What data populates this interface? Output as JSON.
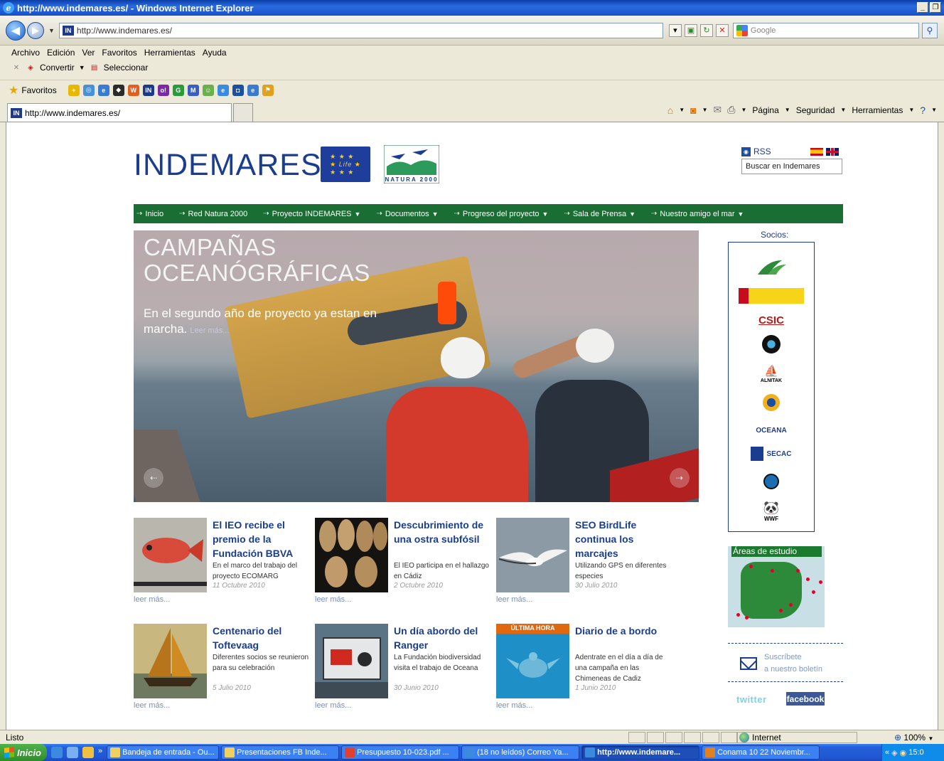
{
  "window": {
    "title": "http://www.indemares.es/ - Windows Internet Explorer",
    "address": "http://www.indemares.es/",
    "search_placeholder": "Google",
    "tab_title": "http://www.indemares.es/"
  },
  "menu": [
    "Archivo",
    "Edición",
    "Ver",
    "Favoritos",
    "Herramientas",
    "Ayuda"
  ],
  "toolbar2": {
    "convert": "Convertir",
    "select": "Seleccionar"
  },
  "favorites_label": "Favoritos",
  "commandbar": {
    "page": "Página",
    "security": "Seguridad",
    "tools": "Herramientas"
  },
  "site": {
    "logo": "INDEMARES",
    "natura_label": "NATURA 2000",
    "rss": "RSS",
    "search_value": "Buscar en Indemares",
    "nav": [
      {
        "label": "Inicio",
        "dropdown": false
      },
      {
        "label": "Red Natura 2000",
        "dropdown": false
      },
      {
        "label": "Proyecto INDEMARES",
        "dropdown": true
      },
      {
        "label": "Documentos",
        "dropdown": true
      },
      {
        "label": "Progreso del proyecto",
        "dropdown": true
      },
      {
        "label": "Sala de Prensa",
        "dropdown": true
      },
      {
        "label": "Nuestro amigo el mar",
        "dropdown": true
      }
    ],
    "hero": {
      "title_line1": "CAMPAÑAS",
      "title_line2": "OCEANÓGRÁFICAS",
      "subtitle": "En el segundo año de proyecto ya estan en marcha.",
      "more": "Leer más..."
    },
    "news": [
      {
        "title": "El IEO recibe el premio de la Fundación BBVA",
        "desc": "En el marco del trabajo del proyecto ECOMARG",
        "date": "11 Octubre 2010",
        "more": "leer más..."
      },
      {
        "title": "Descubrimiento de una ostra subfósil",
        "desc": "El IEO participa en el hallazgo en Cádiz",
        "date": "2 Octubre 2010",
        "more": "leer más..."
      },
      {
        "title": "SEO BirdLife continua los marcajes",
        "desc": "Utilizando GPS en diferentes especies",
        "date": "30 Julio 2010",
        "more": "leer más..."
      },
      {
        "title": "Centenario del Toftevaag",
        "desc": "Diferentes socios se reunieron para su celebración",
        "date": "5 Julio 2010",
        "more": "leer más..."
      },
      {
        "title": "Un día abordo del Ranger",
        "desc": "La Fundación biodiversidad visita el trabajo de Oceana",
        "date": "30 Junio 2010",
        "more": "leer más..."
      },
      {
        "title": "Diario de a bordo",
        "desc": "Adentrate en el día a día de una campaña en las Chimeneas de Cadiz",
        "date": "1 Junio 2010",
        "more": "leer más...",
        "badge": "ÚLTIMA HORA"
      }
    ],
    "socios_title": "Socios:",
    "socios": [
      "Fundación Biodiversidad",
      "Gobierno de España",
      "CSIC",
      "IEO",
      "ALNITAK",
      "CEMMA",
      "OCEANA",
      "SECAC",
      "SEO/BirdLife",
      "WWF"
    ],
    "socios_text": {
      "csic": "CSIC",
      "oceana": "OCEANA",
      "secac": "SECAC",
      "alnitak": "ALNITAK",
      "wwf": "WWF"
    },
    "areas_label": "Áreas de estudio",
    "newsletter_line1": "Suscríbete",
    "newsletter_line2": "a nuestro boletín",
    "twitter": "twitter",
    "facebook": "facebook"
  },
  "status": {
    "text": "Listo",
    "zone": "Internet",
    "zoom": "100%"
  },
  "taskbar": {
    "start": "Inicio",
    "buttons": [
      "Bandeja de entrada - Ou...",
      "Presentaciones FB Inde...",
      "Presupuesto 10-023.pdf ...",
      "(18 no leídos) Correo Ya...",
      "http://www.indemare...",
      "Conama 10 22 Noviembr..."
    ],
    "clock": "15:0"
  }
}
